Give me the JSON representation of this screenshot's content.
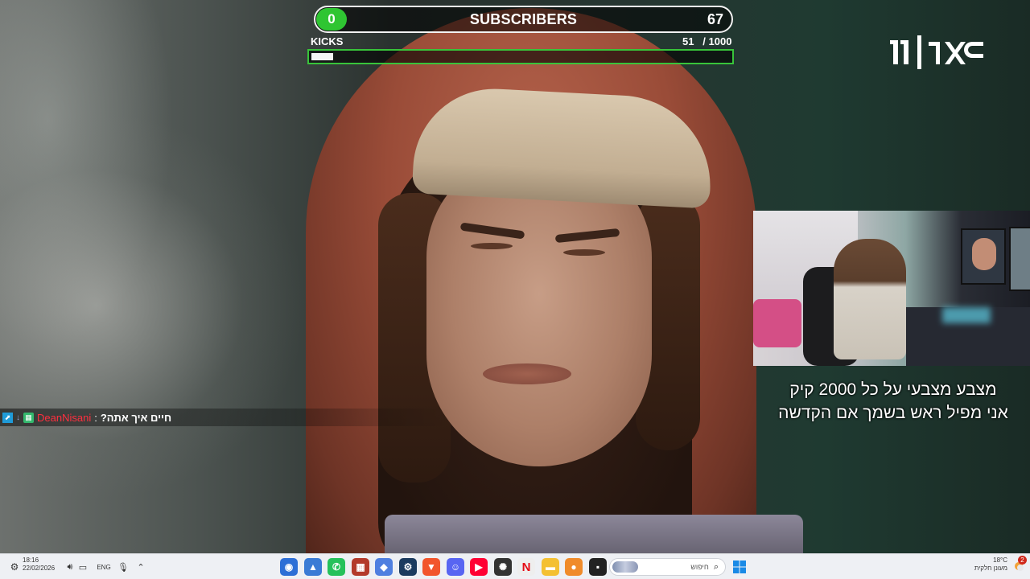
{
  "overlay": {
    "subscribers": {
      "current": "0",
      "title": "SUBSCRIBERS",
      "goal": "67"
    },
    "kicks": {
      "label": "KICKS",
      "progress_text": "51   / 1000",
      "current": 51,
      "goal": 1000
    }
  },
  "channel_logo": {
    "text": "כאן 11"
  },
  "webcam": {
    "caption_line1": "מצבע מצבעי על כל 2000 קיק",
    "caption_line2": "אני  מפיל ראש בשמך  אם הקדשה"
  },
  "chat": {
    "username": "DeanNisani",
    "separator": " : ",
    "message": "חיים איך אתה?"
  },
  "taskbar": {
    "time": "18:16",
    "date": "22/02/2026",
    "language": "ENG",
    "search_placeholder": "חיפוש",
    "weather_temp": "18°C",
    "weather_desc": "מעונן חלקית",
    "notification_count": "2",
    "apps": [
      {
        "name": "chrome-icon",
        "color": "#2d6fd6",
        "glyph": "◉"
      },
      {
        "name": "photos-icon",
        "color": "#3a7bd5",
        "glyph": "▲"
      },
      {
        "name": "whatsapp-icon",
        "color": "#25c15b",
        "glyph": "✆"
      },
      {
        "name": "office-icon",
        "color": "#b33a2b",
        "glyph": "▦"
      },
      {
        "name": "copilot-icon",
        "color": "#4f7fe0",
        "glyph": "◆"
      },
      {
        "name": "steam-icon",
        "color": "#1b3b5f",
        "glyph": "⚙"
      },
      {
        "name": "brave-icon",
        "color": "#f2552c",
        "glyph": "▼"
      },
      {
        "name": "discord-icon",
        "color": "#5865f2",
        "glyph": "☺"
      },
      {
        "name": "youtube-icon",
        "color": "#ff0033",
        "glyph": "▶"
      },
      {
        "name": "chatgpt-icon",
        "color": "#333333",
        "glyph": "✺"
      },
      {
        "name": "netflix-icon",
        "color": "#eeeeee",
        "glyph": "N"
      },
      {
        "name": "file-explorer-icon",
        "color": "#f4c032",
        "glyph": "▬"
      },
      {
        "name": "paint-icon",
        "color": "#f08b2a",
        "glyph": "●"
      },
      {
        "name": "terminal-icon",
        "color": "#222222",
        "glyph": "▪"
      }
    ]
  }
}
